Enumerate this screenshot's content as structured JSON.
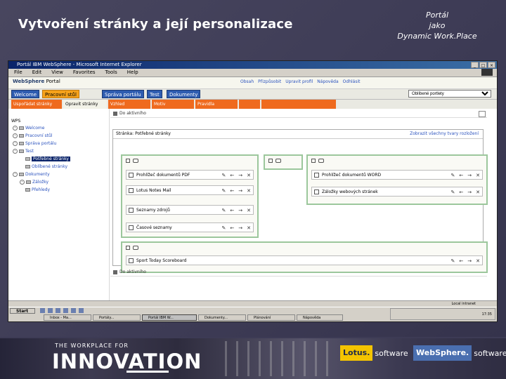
{
  "slide": {
    "title": "Vytvoření stránky a její personalizace",
    "subtitle_line1": "Portál",
    "subtitle_line2": "jako",
    "subtitle_line3": "Dynamic Work.Place"
  },
  "browser": {
    "window_title": "Portál IBM WebSphere - Microsoft Internet Explorer",
    "menu": [
      "File",
      "Edit",
      "View",
      "Favorites",
      "Tools",
      "Help"
    ]
  },
  "portal": {
    "brand_left": "WebSphere",
    "brand_right": "Portal",
    "top_links": [
      "Obsah",
      "Přizpůsobit",
      "Upravit profil",
      "Nápověda",
      "Odhlásit"
    ],
    "tabs": [
      "Welcome",
      "Pracovní stůl",
      "Správa portálu",
      "Test",
      "Dokumenty"
    ],
    "active_tab_index": 1,
    "page_select": "Oblíbené portlety",
    "subtabs": [
      "Uspořádat stránky",
      "Opravit stránky",
      "Vzhled",
      "Motiv",
      "Pravidla"
    ],
    "active_subtab_index": 1
  },
  "tree": {
    "root": "WPS",
    "nodes": [
      {
        "label": "Welcome"
      },
      {
        "label": "Pracovní stůl"
      },
      {
        "label": "Správa portálu"
      },
      {
        "label": "Test"
      },
      {
        "label": "Potřebné stránky",
        "selected": true
      },
      {
        "label": "Oblíbené stránky"
      },
      {
        "label": "Dokumenty"
      },
      {
        "label": "Záložky"
      },
      {
        "label": "Přehledy"
      }
    ]
  },
  "editor": {
    "top_bar": "Do aktivního",
    "bottom_bar": "Do aktivního",
    "page_label": "Stránka: Potřebné stránky",
    "page_link": "Zobrazit všechny tvary rozložení",
    "col1_portlets": [
      "Prohlížeč dokumentů PDF",
      "Lotus Notes Mail",
      "Seznamy zdrojů",
      "Časové seznamy"
    ],
    "col2_portlets": [],
    "col3_portlets": [
      "Prohlížeč dokumentů WORD",
      "Záložky webových stránek"
    ],
    "row_portlets": [
      "Sport Today Scoreboard"
    ]
  },
  "taskbar": {
    "start": "Start",
    "buttons": [
      "Inbox - Ma...",
      "Portály...",
      "Portál IBM W...",
      "Dokumenty...",
      "Plánování",
      "Nápověda"
    ],
    "active_index": 2,
    "tray_time": "17:35",
    "zone": "Local intranet"
  },
  "banner": {
    "tagline": "THE WORKPLACE FOR",
    "headline": "INNOVATION",
    "lotus_mark": "Lotus.",
    "lotus_word": "software",
    "websphere_mark": "WebSphere.",
    "websphere_word": "software"
  }
}
